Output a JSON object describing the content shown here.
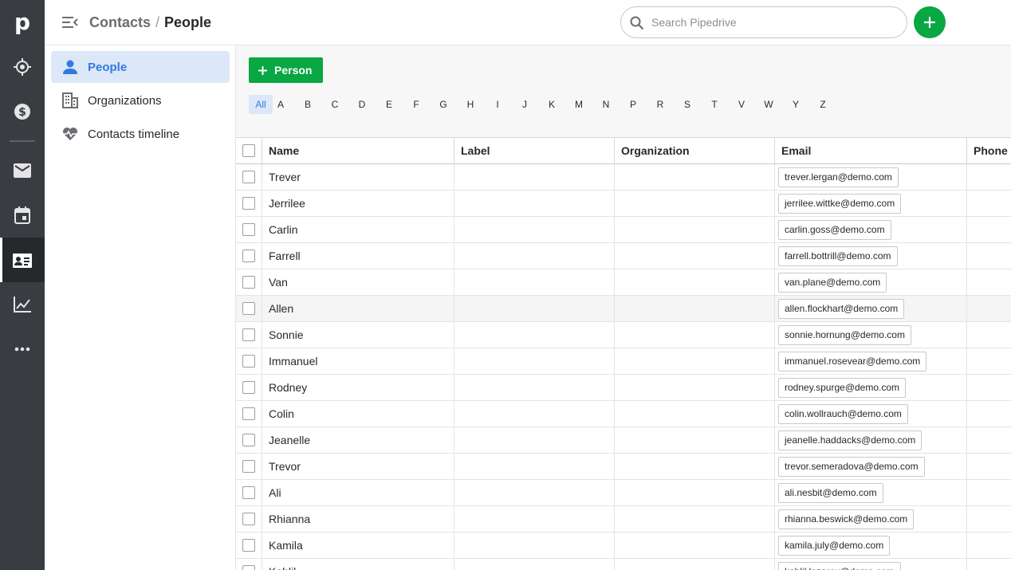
{
  "rail": {
    "logo": "p",
    "items": [
      {
        "icon": "target-icon",
        "name": "rail-leads"
      },
      {
        "icon": "dollar-icon",
        "name": "rail-deals"
      },
      {
        "icon": "mail-icon",
        "name": "rail-mail"
      },
      {
        "icon": "calendar-icon",
        "name": "rail-activities"
      },
      {
        "icon": "contacts-card-icon",
        "name": "rail-contacts"
      },
      {
        "icon": "chart-icon",
        "name": "rail-insights"
      },
      {
        "icon": "more-icon",
        "name": "rail-more"
      }
    ]
  },
  "header": {
    "breadcrumb_parent": "Contacts",
    "breadcrumb_sep": "/",
    "breadcrumb_current": "People",
    "search_placeholder": "Search Pipedrive"
  },
  "subnav": {
    "items": [
      {
        "label": "People",
        "icon": "person-icon",
        "active": true
      },
      {
        "label": "Organizations",
        "icon": "building-icon",
        "active": false
      },
      {
        "label": "Contacts timeline",
        "icon": "heartbeat-icon",
        "active": false
      }
    ]
  },
  "toolbar": {
    "add_person_label": "Person"
  },
  "alphabet": [
    "All",
    "A",
    "B",
    "C",
    "D",
    "E",
    "F",
    "G",
    "H",
    "I",
    "J",
    "K",
    "M",
    "N",
    "P",
    "R",
    "S",
    "T",
    "V",
    "W",
    "Y",
    "Z"
  ],
  "alphabet_selected": "All",
  "table": {
    "columns": [
      "Name",
      "Label",
      "Organization",
      "Email",
      "Phone"
    ],
    "rows": [
      {
        "name": "Trever",
        "email": "trever.lergan@demo.com"
      },
      {
        "name": "Jerrilee",
        "email": "jerrilee.wittke@demo.com"
      },
      {
        "name": "Carlin",
        "email": "carlin.goss@demo.com"
      },
      {
        "name": "Farrell",
        "email": "farrell.bottrill@demo.com"
      },
      {
        "name": "Van",
        "email": "van.plane@demo.com"
      },
      {
        "name": "Allen",
        "email": "allen.flockhart@demo.com",
        "highlighted": true
      },
      {
        "name": "Sonnie",
        "email": "sonnie.hornung@demo.com"
      },
      {
        "name": "Immanuel",
        "email": "immanuel.rosevear@demo.com"
      },
      {
        "name": "Rodney",
        "email": "rodney.spurge@demo.com"
      },
      {
        "name": "Colin",
        "email": "colin.wollrauch@demo.com"
      },
      {
        "name": "Jeanelle",
        "email": "jeanelle.haddacks@demo.com"
      },
      {
        "name": "Trevor",
        "email": "trevor.semeradova@demo.com"
      },
      {
        "name": "Ali",
        "email": "ali.nesbit@demo.com"
      },
      {
        "name": "Rhianna",
        "email": "rhianna.beswick@demo.com"
      },
      {
        "name": "Kamila",
        "email": "kamila.july@demo.com"
      },
      {
        "name": "Kahlil",
        "email": "kahlil.lazarov@demo.com"
      }
    ]
  },
  "colors": {
    "rail_bg": "#393d42",
    "accent_green": "#08a742",
    "accent_blue": "#317ae2",
    "active_bg": "#dce8f7"
  }
}
